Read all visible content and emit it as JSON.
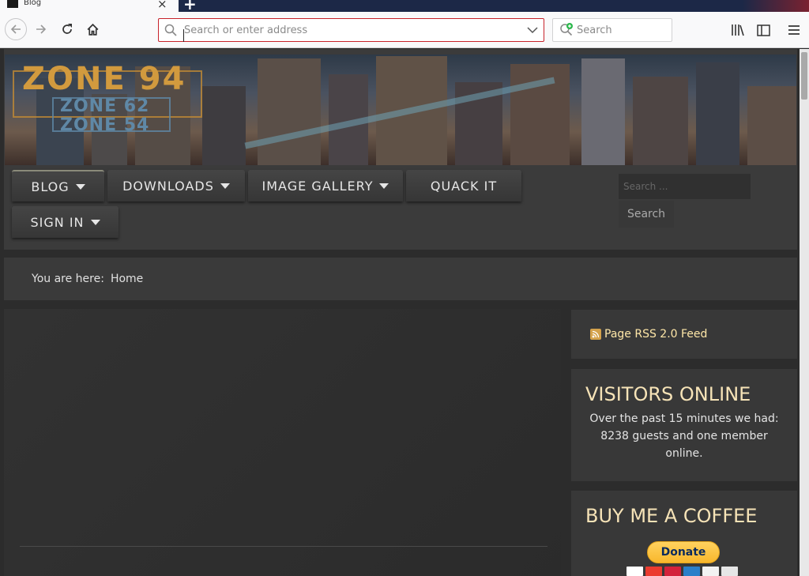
{
  "browser": {
    "tab_title": "Blog",
    "url_placeholder": "Search or enter address",
    "search_placeholder": "Search"
  },
  "site": {
    "logo": {
      "main": "ZONE 94",
      "sub1": "ZONE 62",
      "sub2": "ZONE 54"
    },
    "menu": [
      {
        "label": "BLOG",
        "dropdown": true
      },
      {
        "label": "DOWNLOADS",
        "dropdown": true
      },
      {
        "label": "IMAGE GALLERY",
        "dropdown": true
      },
      {
        "label": "QUACK IT",
        "dropdown": false
      },
      {
        "label": "SIGN IN",
        "dropdown": true
      }
    ],
    "search": {
      "placeholder": "Search ...",
      "button": "Search"
    },
    "breadcrumb": {
      "label": "You are here:",
      "current": "Home"
    },
    "rss": {
      "label": "Page RSS 2.0 Feed"
    },
    "visitors": {
      "title": "VISITORS ONLINE",
      "text": "Over the past 15 minutes we had: 8238 guests and one member online."
    },
    "coffee": {
      "title": "BUY ME A COFFEE",
      "donate_label": "Donate"
    }
  },
  "colors": {
    "accent_title": "#f6e3b7",
    "rss_link": "#ffe7a8",
    "url_focus_border": "#c7222a"
  }
}
